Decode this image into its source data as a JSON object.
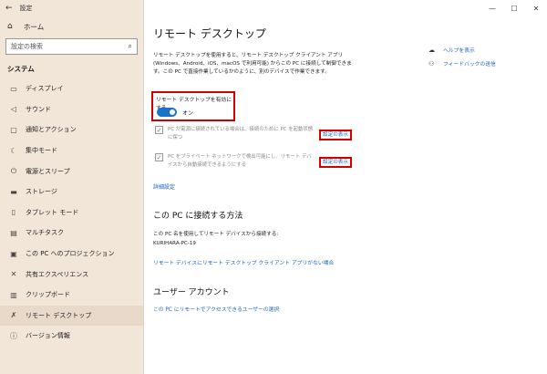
{
  "window": {
    "title": "設定"
  },
  "sidebar": {
    "home": "ホーム",
    "search_placeholder": "設定の検索",
    "section": "システム",
    "items": [
      {
        "label": "ディスプレイ",
        "icon": "monitor-icon"
      },
      {
        "label": "サウンド",
        "icon": "speaker-icon"
      },
      {
        "label": "通知とアクション",
        "icon": "notification-icon"
      },
      {
        "label": "集中モード",
        "icon": "moon-icon"
      },
      {
        "label": "電源とスリープ",
        "icon": "power-icon"
      },
      {
        "label": "ストレージ",
        "icon": "storage-icon"
      },
      {
        "label": "タブレット モード",
        "icon": "tablet-icon"
      },
      {
        "label": "マルチタスク",
        "icon": "multitask-icon"
      },
      {
        "label": "この PC へのプロジェクション",
        "icon": "projection-icon"
      },
      {
        "label": "共有エクスペリエンス",
        "icon": "share-icon"
      },
      {
        "label": "クリップボード",
        "icon": "clipboard-icon"
      },
      {
        "label": "リモート デスクトップ",
        "icon": "remote-desktop-icon"
      },
      {
        "label": "バージョン情報",
        "icon": "info-icon"
      }
    ]
  },
  "main": {
    "title": "リモート デスクトップ",
    "description": "リモート デスクトップを使用すると、リモート デスクトップ クライアント アプリ (Windows、Android、iOS、macOS で利用可能) からこの PC に接続して制御できます。この PC で直接作業しているかのように、別のデバイスで作業できます。",
    "enable_label": "リモート デスクトップを有効にする",
    "toggle_state": "オン",
    "options": [
      {
        "text": "PC が電源に接続されている場合は、接続のために PC を起動状態に保つ",
        "link": "設定の表示"
      },
      {
        "text": "PC をプライベート ネットワークで検出可能にし、リモート デバイスから自動接続できるようにする",
        "link": "設定の表示"
      }
    ],
    "advanced_link": "詳細設定",
    "connect_heading": "この PC に接続する方法",
    "connect_info": "この PC 名を使用してリモート デバイスから接続する:",
    "pc_name": "KURIHARA-PC-19",
    "no_client_link": "リモート デバイスにリモート デスクトップ クライアント アプリがない場合",
    "user_heading": "ユーザー アカウント",
    "user_link": "この PC にリモートでアクセスできるユーザーの選択"
  },
  "help": {
    "help_link": "ヘルプを表示",
    "feedback_link": "フィードバックの送信"
  }
}
